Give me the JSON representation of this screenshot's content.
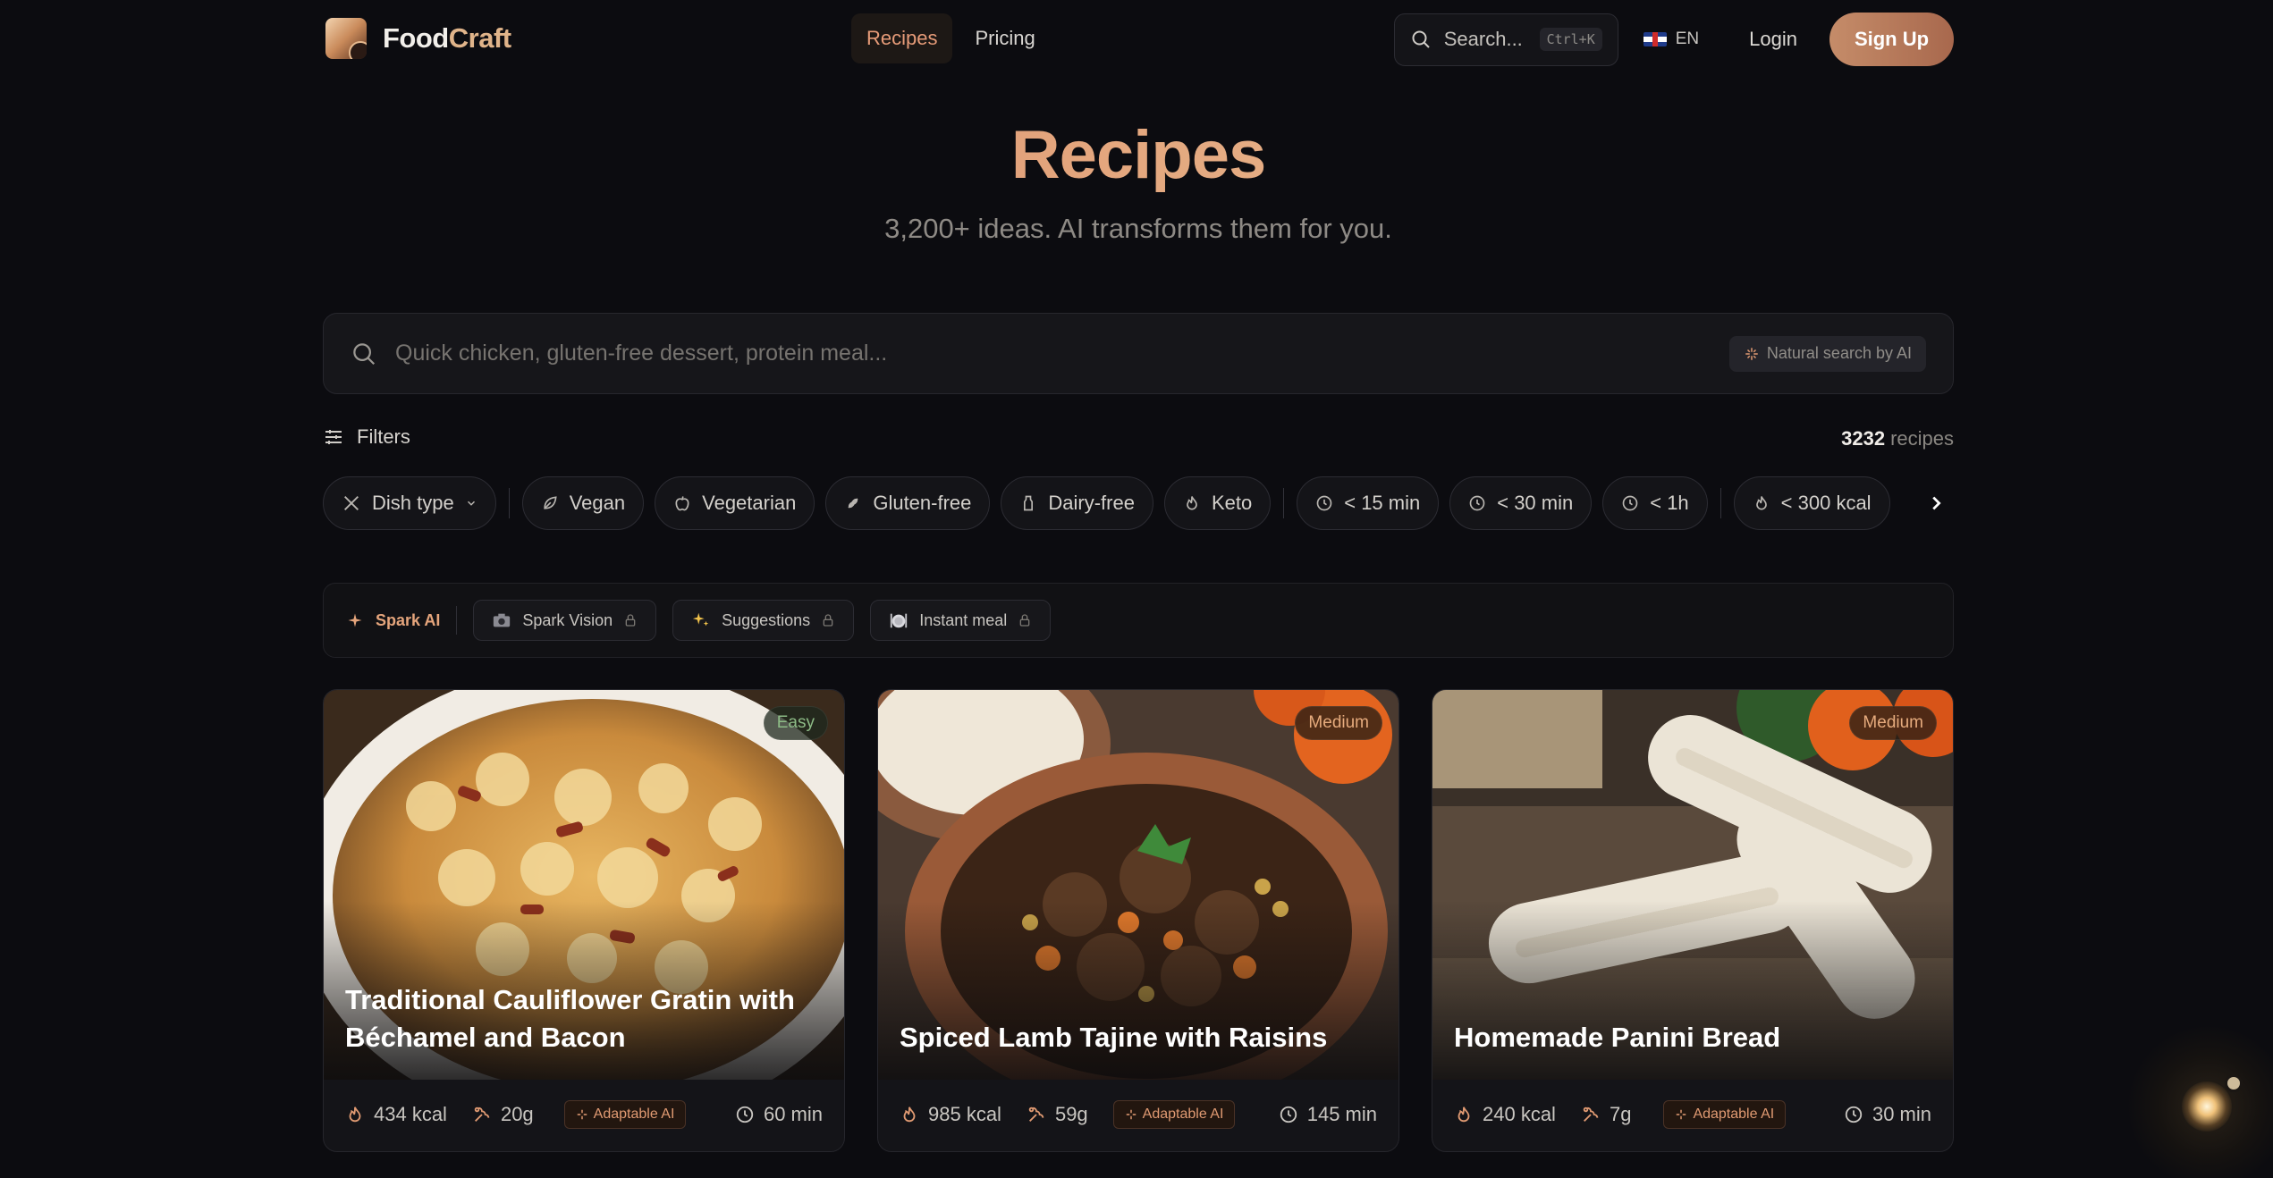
{
  "brand": {
    "name_a": "Food",
    "name_b": "Craft"
  },
  "nav": {
    "links": [
      {
        "label": "Recipes",
        "active": true
      },
      {
        "label": "Pricing",
        "active": false
      }
    ],
    "search_label": "Search...",
    "search_shortcut": "Ctrl+K",
    "language": "EN",
    "login": "Login",
    "signup": "Sign Up"
  },
  "hero": {
    "title": "Recipes",
    "subtitle": "3,200+ ideas. AI transforms them for you."
  },
  "search": {
    "placeholder": "Quick chicken, gluten-free dessert, protein meal...",
    "ai_chip": "Natural search by AI"
  },
  "filters": {
    "label": "Filters",
    "count_value": "3232",
    "count_unit": "recipes",
    "chips": {
      "dish_type": "Dish type",
      "vegan": "Vegan",
      "vegetarian": "Vegetarian",
      "gluten_free": "Gluten-free",
      "dairy_free": "Dairy-free",
      "keto": "Keto",
      "t15": "< 15 min",
      "t30": "< 30 min",
      "t1h": "< 1h",
      "kcal300": "< 300 kcal"
    }
  },
  "spark": {
    "title": "Spark AI",
    "buttons": [
      "Spark Vision",
      "Suggestions",
      "Instant meal"
    ]
  },
  "recipes": [
    {
      "title": "Traditional Cauliflower Gratin with Béchamel and Bacon",
      "difficulty": "Easy",
      "kcal": "434 kcal",
      "protein": "20g",
      "ai": "Adaptable AI",
      "time": "60 min"
    },
    {
      "title": "Spiced Lamb Tajine with Raisins",
      "difficulty": "Medium",
      "kcal": "985 kcal",
      "protein": "59g",
      "ai": "Adaptable AI",
      "time": "145 min"
    },
    {
      "title": "Homemade Panini Bread",
      "difficulty": "Medium",
      "kcal": "240 kcal",
      "protein": "7g",
      "ai": "Adaptable AI",
      "time": "30 min"
    }
  ],
  "colors": {
    "accent": "#e09a72",
    "background": "#0c0c10",
    "easy": "#8dbb86"
  },
  "icons": [
    "search-icon",
    "sliders-icon",
    "sparkle-icon",
    "flame-icon",
    "protein-icon",
    "clock-icon",
    "lock-icon",
    "chevron-right-icon"
  ]
}
